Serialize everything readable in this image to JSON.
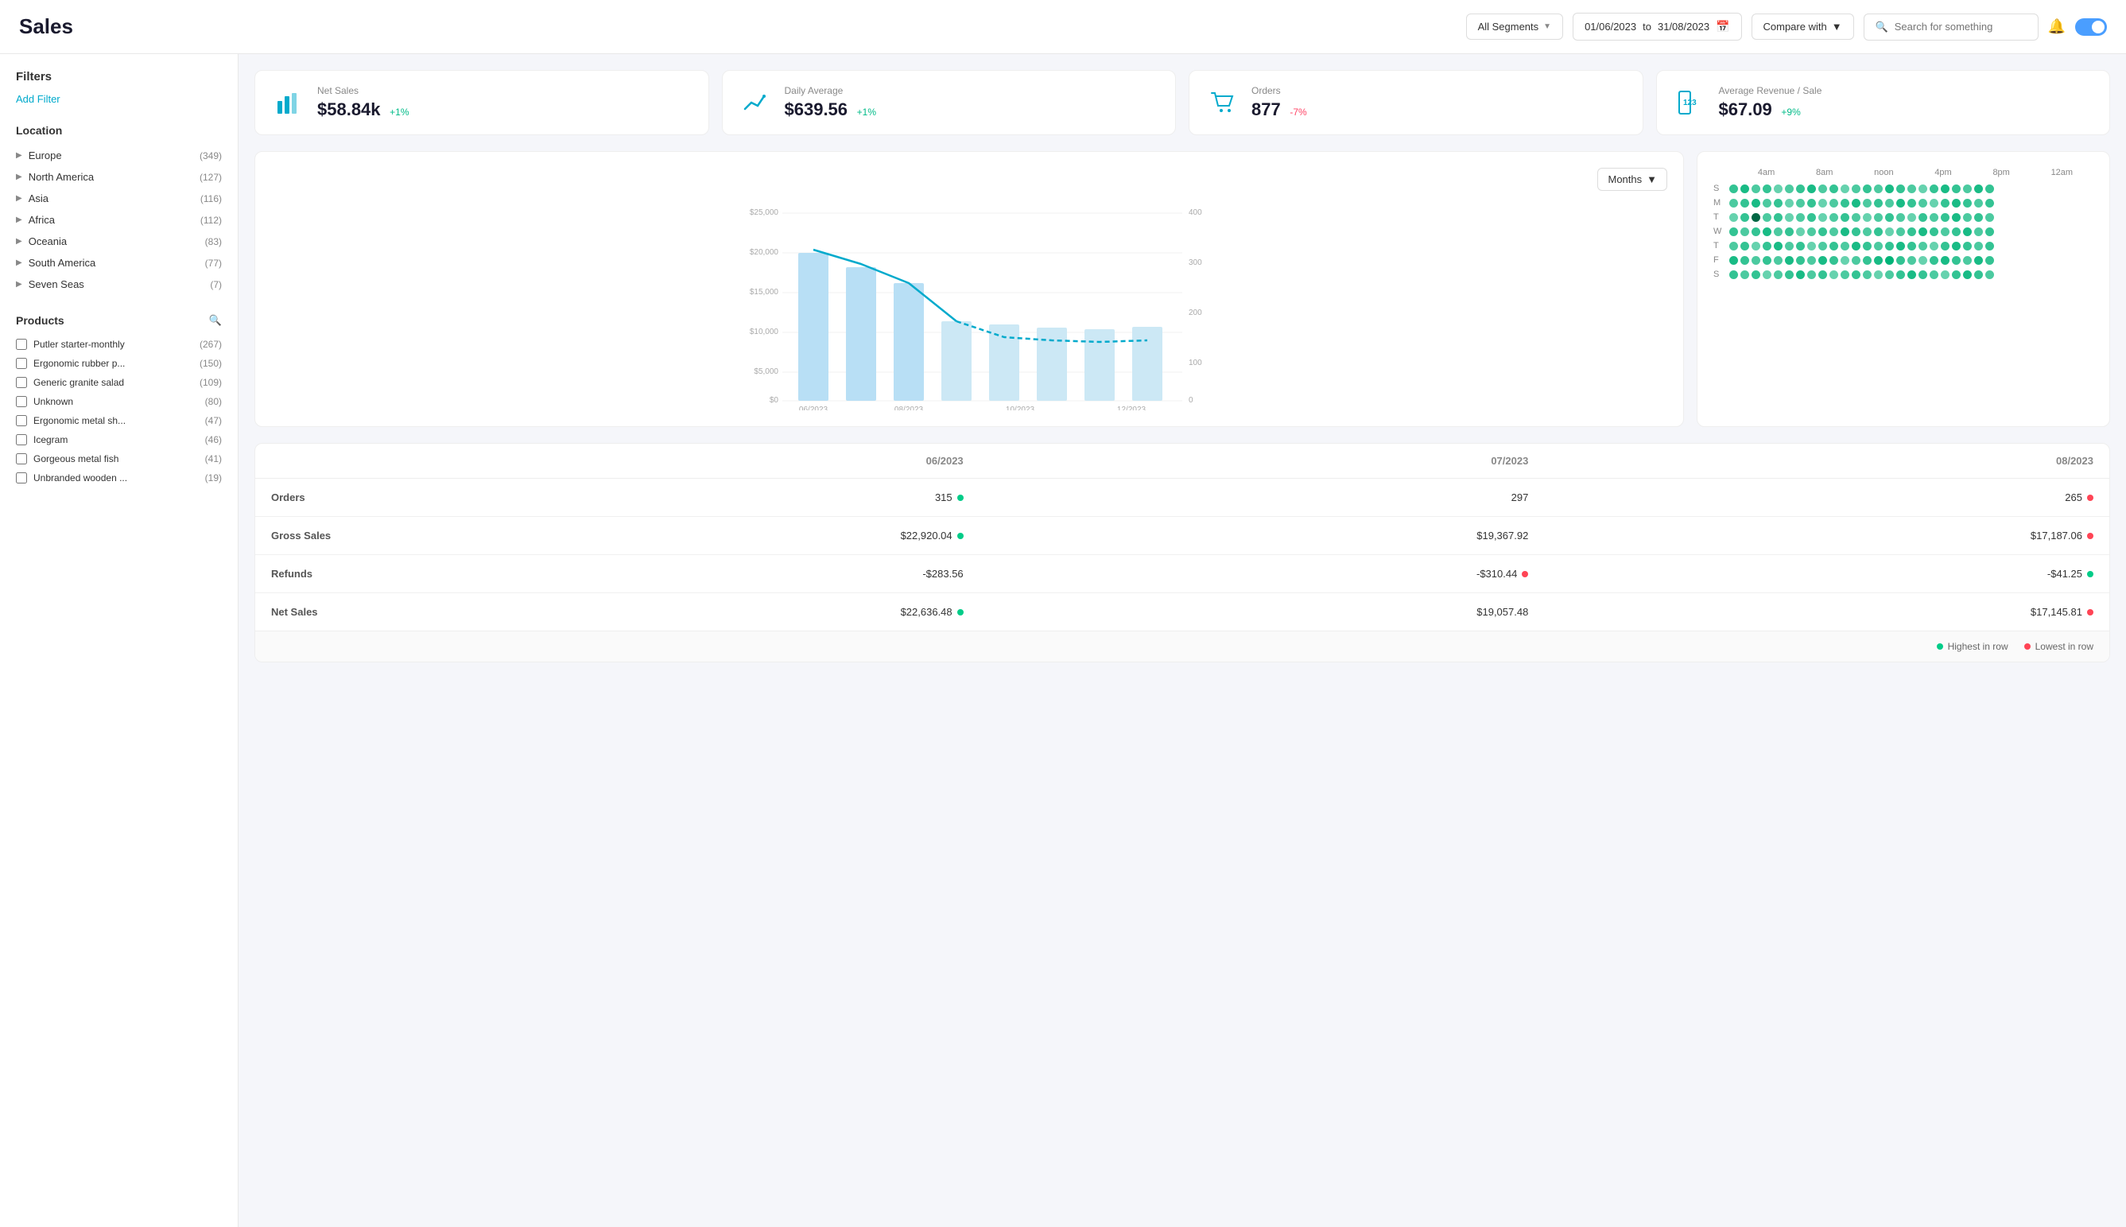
{
  "header": {
    "title": "Sales",
    "segment_label": "All Segments",
    "date_from": "01/06/2023",
    "date_to": "31/08/2023",
    "date_separator": "to",
    "compare_label": "Compare with",
    "search_placeholder": "Search for something"
  },
  "kpis": [
    {
      "id": "net-sales",
      "label": "Net Sales",
      "value": "$58.84k",
      "change": "+1%",
      "change_type": "positive",
      "icon": "bar-chart"
    },
    {
      "id": "daily-avg",
      "label": "Daily Average",
      "value": "$639.56",
      "change": "+1%",
      "change_type": "positive",
      "icon": "line-chart"
    },
    {
      "id": "orders",
      "label": "Orders",
      "value": "877",
      "change": "-7%",
      "change_type": "negative",
      "icon": "cart"
    },
    {
      "id": "avg-revenue",
      "label": "Average Revenue / Sale",
      "value": "$67.09",
      "change": "+9%",
      "change_type": "positive",
      "icon": "tag"
    }
  ],
  "chart": {
    "months_label": "Months",
    "y_labels_left": [
      "$25,000",
      "$20,000",
      "$15,000",
      "$10,000",
      "$5,000",
      "$0"
    ],
    "y_labels_right": [
      "400",
      "300",
      "200",
      "100",
      "0"
    ],
    "x_labels": [
      "06/2023",
      "08/2023",
      "10/2023",
      "12/2023"
    ]
  },
  "heatmap": {
    "time_labels": [
      "4am",
      "8am",
      "noon",
      "4pm",
      "8pm",
      "12am"
    ],
    "days": [
      "S",
      "M",
      "T",
      "W",
      "T",
      "F",
      "S"
    ]
  },
  "filters": {
    "title": "Filters",
    "add_filter": "Add Filter",
    "location_title": "Location",
    "locations": [
      {
        "name": "Europe",
        "count": "(349)"
      },
      {
        "name": "North America",
        "count": "(127)"
      },
      {
        "name": "Asia",
        "count": "(116)"
      },
      {
        "name": "Africa",
        "count": "(112)"
      },
      {
        "name": "Oceania",
        "count": "(83)"
      },
      {
        "name": "South America",
        "count": "(77)"
      },
      {
        "name": "Seven Seas",
        "count": "(7)"
      }
    ],
    "products_title": "Products",
    "products": [
      {
        "name": "Putler starter-monthly",
        "count": "(267)"
      },
      {
        "name": "Ergonomic rubber p...",
        "count": "(150)"
      },
      {
        "name": "Generic granite salad",
        "count": "(109)"
      },
      {
        "name": "Unknown",
        "count": "(80)"
      },
      {
        "name": "Ergonomic metal sh...",
        "count": "(47)"
      },
      {
        "name": "Icegram",
        "count": "(46)"
      },
      {
        "name": "Gorgeous metal fish",
        "count": "(41)"
      },
      {
        "name": "Unbranded wooden ...",
        "count": "(19)"
      }
    ]
  },
  "data_table": {
    "col_headers": [
      "",
      "06/2023",
      "07/2023",
      "08/2023"
    ],
    "rows": [
      {
        "label": "Orders",
        "values": [
          {
            "val": "315",
            "dot": "green"
          },
          {
            "val": "297",
            "dot": "none"
          },
          {
            "val": "265",
            "dot": "red"
          }
        ]
      },
      {
        "label": "Gross Sales",
        "values": [
          {
            "val": "$22,920.04",
            "dot": "green"
          },
          {
            "val": "$19,367.92",
            "dot": "none"
          },
          {
            "val": "$17,187.06",
            "dot": "red"
          }
        ]
      },
      {
        "label": "Refunds",
        "values": [
          {
            "val": "-$283.56",
            "dot": "none"
          },
          {
            "val": "-$310.44",
            "dot": "red"
          },
          {
            "val": "-$41.25",
            "dot": "green"
          }
        ]
      },
      {
        "label": "Net Sales",
        "values": [
          {
            "val": "$22,636.48",
            "dot": "green"
          },
          {
            "val": "$19,057.48",
            "dot": "none"
          },
          {
            "val": "$17,145.81",
            "dot": "red"
          }
        ]
      }
    ],
    "legend": {
      "highest": "Highest in row",
      "lowest": "Lowest in row"
    }
  },
  "colors": {
    "teal": "#00aacc",
    "green": "#00cc88",
    "red": "#ff4455",
    "accent_blue": "#4a9eff"
  }
}
